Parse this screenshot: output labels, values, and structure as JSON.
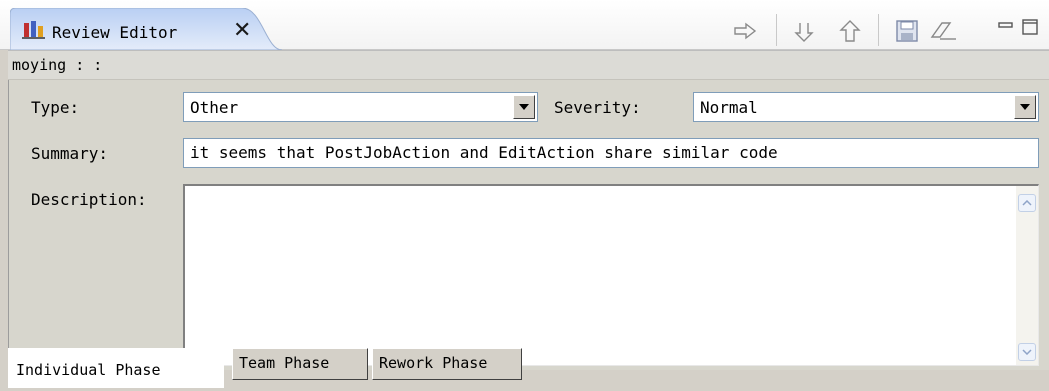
{
  "editor_tab": {
    "title": "Review Editor",
    "icon": "review-editor-icon",
    "close": "✕"
  },
  "toolbar": {
    "icons": [
      "next-arrow-icon",
      "next-down-icon",
      "previous-up-icon",
      "save-icon",
      "clear-icon",
      "minimize-icon",
      "maximize-icon"
    ]
  },
  "owner_line": "moying :  :",
  "form": {
    "type_label": "Type:",
    "type_value": "Other",
    "severity_label": "Severity:",
    "severity_value": "Normal",
    "summary_label": "Summary:",
    "summary_value": "it seems that PostJobAction and EditAction share similar code",
    "description_label": "Description:",
    "description_value": ""
  },
  "phase_tabs": [
    {
      "label": "Individual Phase",
      "active": true
    },
    {
      "label": "Team Phase",
      "active": false
    },
    {
      "label": "Rework Phase",
      "active": false
    }
  ],
  "colors": {
    "tab_blue": "#c8d9f5",
    "form_bg": "#d7d6cd",
    "field_border": "#7f9db9"
  }
}
